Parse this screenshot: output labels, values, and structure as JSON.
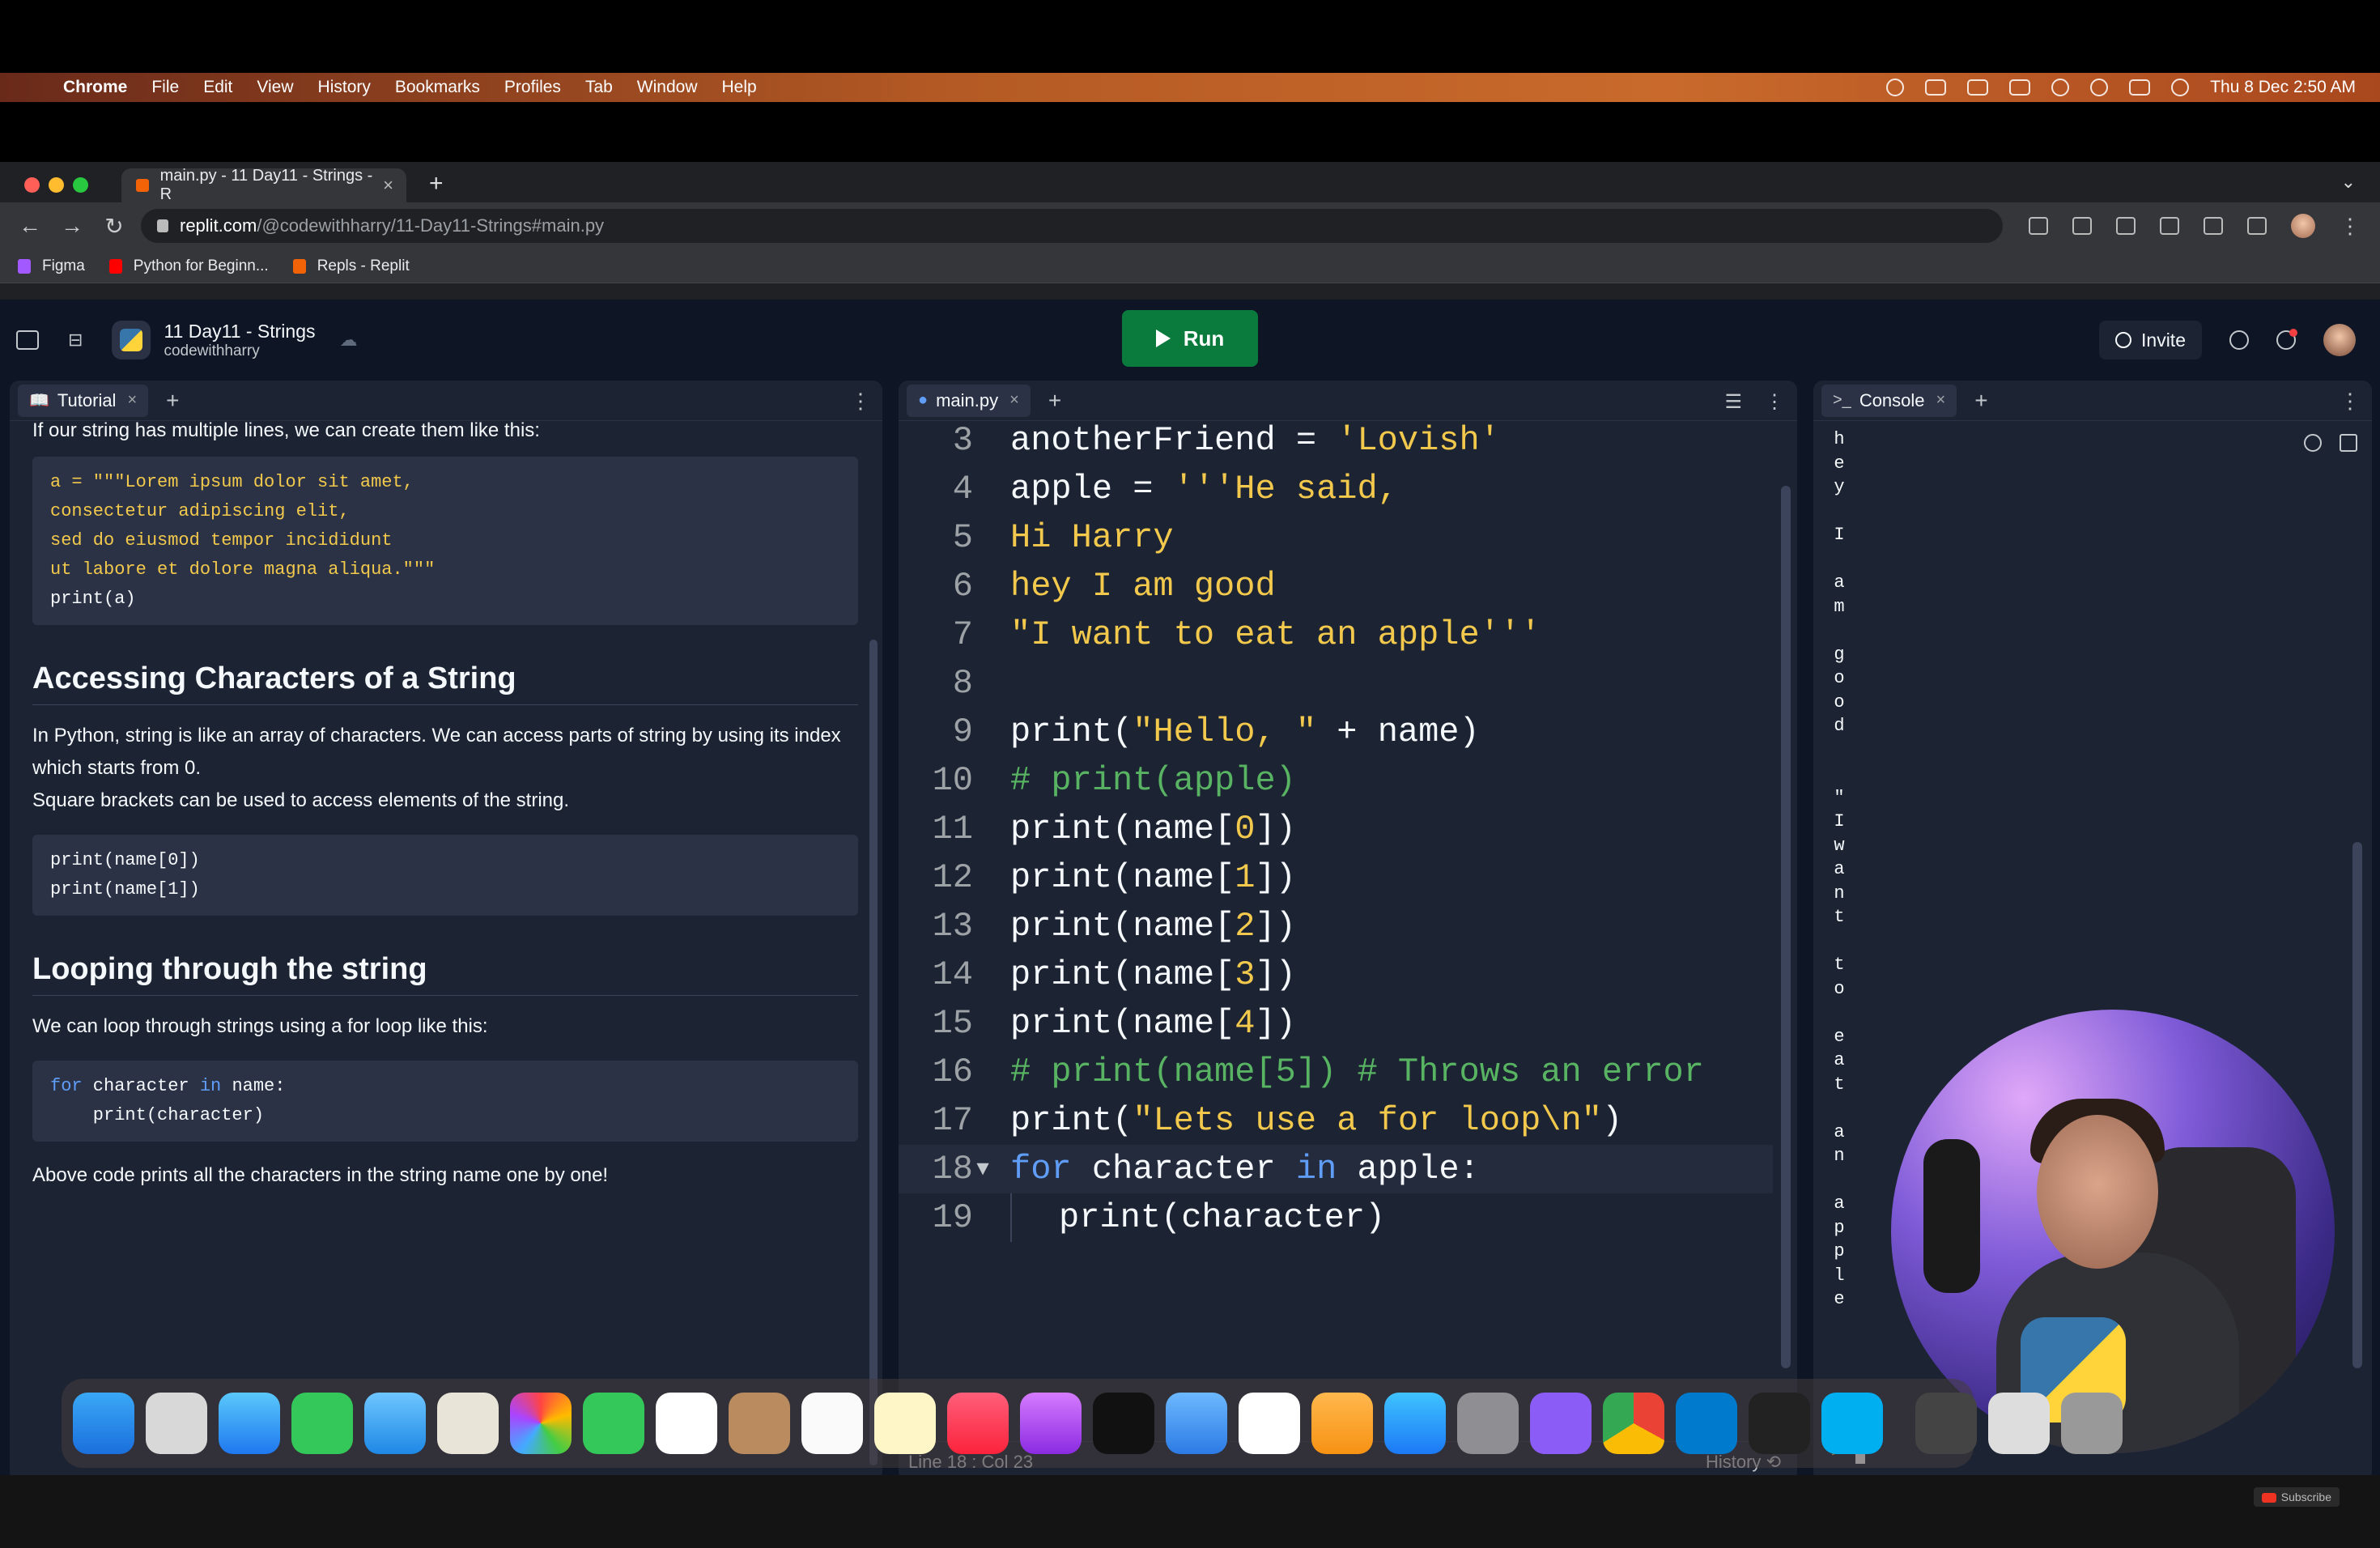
{
  "menubar": {
    "app": "Chrome",
    "items": [
      "File",
      "Edit",
      "View",
      "History",
      "Bookmarks",
      "Profiles",
      "Tab",
      "Window",
      "Help"
    ],
    "datetime": "Thu 8 Dec  2:50 AM"
  },
  "browser": {
    "tab_title": "main.py - 11 Day11 - Strings - R",
    "url_host": "replit.com",
    "url_path": "/@codewithharry/11-Day11-Strings#main.py",
    "bookmarks": [
      "Figma",
      "Python for Beginn...",
      "Repls - Replit"
    ]
  },
  "replit": {
    "project_name": "11 Day11 - Strings",
    "owner": "codewithharry",
    "run_label": "Run",
    "invite_label": "Invite",
    "accent": "#0b7a3d"
  },
  "tutorial": {
    "tab_label": "Tutorial",
    "intro": "If our string has multiple lines, we can create them like this:",
    "code1": [
      "a = \"\"\"Lorem ipsum dolor sit amet,",
      "consectetur adipiscing elit,",
      "sed do eiusmod tempor incididunt",
      "ut labore et dolore magna aliqua.\"\"\"",
      "print(a)"
    ],
    "h_access": "Accessing Characters of a String",
    "p_access1": "In Python, string is like an array of characters. We can access parts of string by using its index which starts from 0.",
    "p_access2": "Square brackets can be used to access elements of the string.",
    "code2": [
      "print(name[0])",
      "print(name[1])"
    ],
    "h_loop": "Looping through the string",
    "p_loop": "We can loop through strings using a for loop like this:",
    "code3_line1_kw1": "for",
    "code3_line1_mid": " character ",
    "code3_line1_kw2": "in",
    "code3_line1_end": " name:",
    "code3_line2": "    print(character)",
    "p_end": "Above code prints all the characters in the string name one by one!"
  },
  "editor": {
    "tab_label": "main.py",
    "lines": [
      {
        "n": "3",
        "text": "anotherFriend = 'Lovish'"
      },
      {
        "n": "4",
        "text": "apple = '''He said,"
      },
      {
        "n": "5",
        "text": "Hi Harry"
      },
      {
        "n": "6",
        "text": "hey I am good"
      },
      {
        "n": "7",
        "text": "\"I want to eat an apple'''"
      },
      {
        "n": "8",
        "text": ""
      },
      {
        "n": "9",
        "text": "print(\"Hello, \" + name)"
      },
      {
        "n": "10",
        "text": "# print(apple)"
      },
      {
        "n": "11",
        "text": "print(name[0])"
      },
      {
        "n": "12",
        "text": "print(name[1])"
      },
      {
        "n": "13",
        "text": "print(name[2])"
      },
      {
        "n": "14",
        "text": "print(name[3])"
      },
      {
        "n": "15",
        "text": "print(name[4])"
      },
      {
        "n": "16",
        "text": "# print(name[5]) # Throws an error"
      },
      {
        "n": "17",
        "text": "print(\"Lets use a for loop\\n\")"
      },
      {
        "n": "18",
        "text": "for character in apple:"
      },
      {
        "n": "19",
        "text": "print(character)"
      }
    ],
    "status_pos": "Line 18 : Col 23",
    "history_label": "History"
  },
  "console": {
    "tab_label": "Console",
    "output_chars": [
      "h",
      "e",
      "y",
      "",
      "I",
      "",
      "a",
      "m",
      "",
      "g",
      "o",
      "o",
      "d",
      "",
      "",
      "\"",
      "I",
      "w",
      "a",
      "n",
      "t",
      "",
      "t",
      "o",
      "",
      "e",
      "a",
      "t",
      "",
      "a",
      "n",
      "",
      "a",
      "p",
      "p",
      "l",
      "e"
    ],
    "prompt": ">"
  },
  "overlay": {
    "subscribe": "Subscribe"
  }
}
